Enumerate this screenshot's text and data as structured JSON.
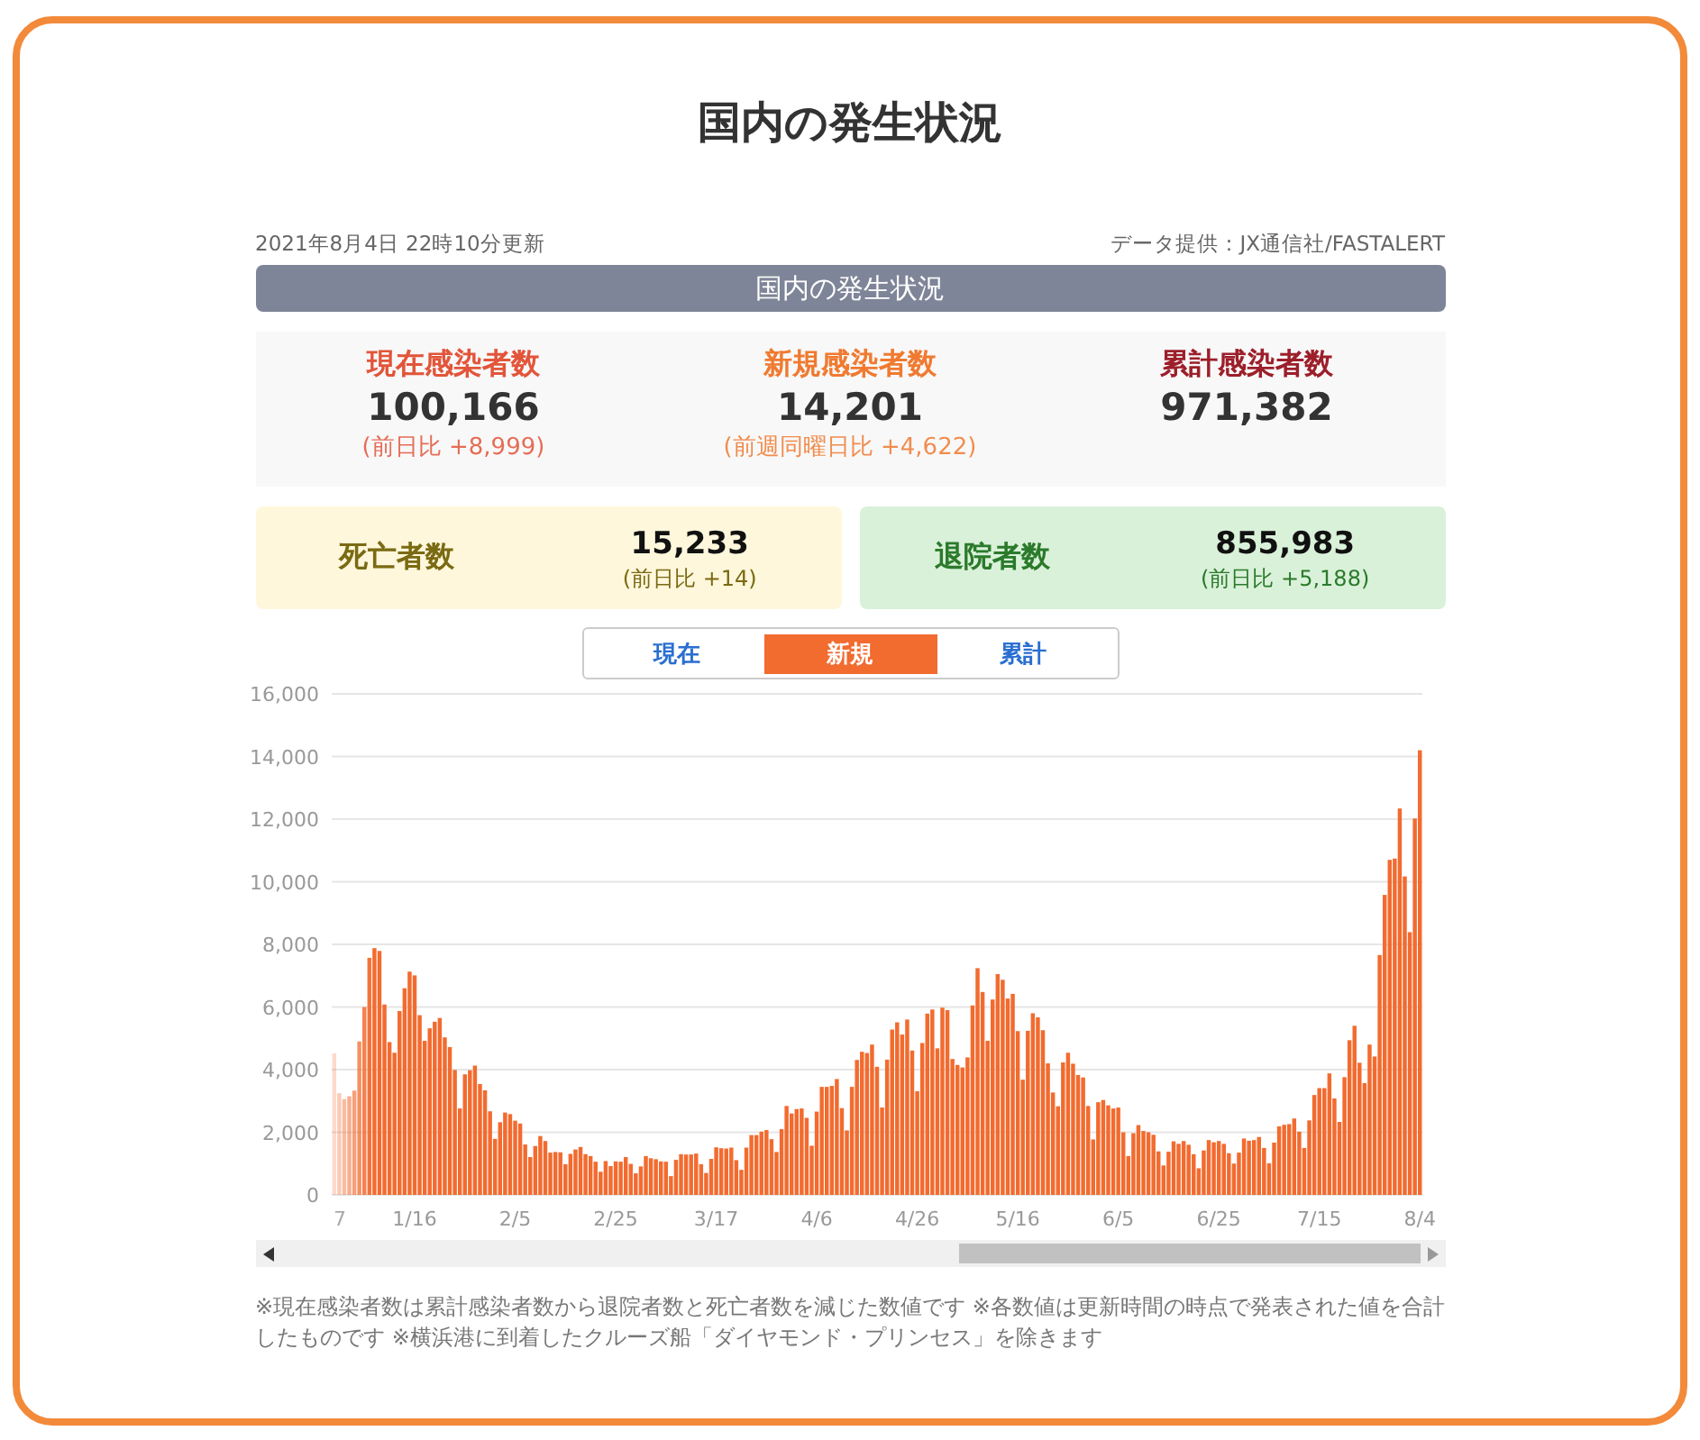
{
  "title": "国内の発生状況",
  "updated": "2021年8月4日 22時10分更新",
  "source": "データ提供：JX通信社/FASTALERT",
  "section_header": "国内の発生状況",
  "stats": [
    {
      "label": "現在感染者数",
      "value": "100,166",
      "change": "(前日比 +8,999)",
      "color": "#e2553a"
    },
    {
      "label": "新規感染者数",
      "value": "14,201",
      "change": "(前週同曜日比 +4,622)",
      "color": "#f07a30"
    },
    {
      "label": "累計感染者数",
      "value": "971,382",
      "color": "#9c1f2a"
    }
  ],
  "cards": [
    {
      "kind": "deaths",
      "label": "死亡者数",
      "value": "15,233",
      "change": "(前日比 +14)"
    },
    {
      "kind": "recovered",
      "label": "退院者数",
      "value": "855,983",
      "change": "(前日比 +5,188)"
    }
  ],
  "tabs": [
    {
      "label": "現在",
      "selected": false
    },
    {
      "label": "新規",
      "selected": true
    },
    {
      "label": "累計",
      "selected": false
    }
  ],
  "chart_data": {
    "type": "bar",
    "grid": true,
    "ylim": [
      0,
      16000
    ],
    "yticks": [
      {
        "value": 0,
        "label": "0"
      },
      {
        "value": 2000,
        "label": "2,000"
      },
      {
        "value": 4000,
        "label": "4,000"
      },
      {
        "value": 6000,
        "label": "6,000"
      },
      {
        "value": 8000,
        "label": "8,000"
      },
      {
        "value": 10000,
        "label": "10,000"
      },
      {
        "value": 12000,
        "label": "12,000"
      },
      {
        "value": 14000,
        "label": "14,000"
      },
      {
        "value": 16000,
        "label": "16,000"
      }
    ],
    "categories": [
      "7",
      null,
      null,
      null,
      null,
      null,
      null,
      null,
      null,
      null,
      null,
      null,
      null,
      null,
      null,
      null,
      "1/16",
      null,
      null,
      null,
      null,
      null,
      null,
      null,
      null,
      null,
      null,
      null,
      null,
      null,
      null,
      null,
      null,
      null,
      null,
      null,
      "2/5",
      null,
      null,
      null,
      null,
      null,
      null,
      null,
      null,
      null,
      null,
      null,
      null,
      null,
      null,
      null,
      null,
      null,
      null,
      null,
      "2/25",
      null,
      null,
      null,
      null,
      null,
      null,
      null,
      null,
      null,
      null,
      null,
      null,
      null,
      null,
      null,
      null,
      null,
      null,
      null,
      "3/17",
      null,
      null,
      null,
      null,
      null,
      null,
      null,
      null,
      null,
      null,
      null,
      null,
      null,
      null,
      null,
      null,
      null,
      null,
      null,
      "4/6",
      null,
      null,
      null,
      null,
      null,
      null,
      null,
      null,
      null,
      null,
      null,
      null,
      null,
      null,
      null,
      null,
      null,
      null,
      null,
      "4/26",
      null,
      null,
      null,
      null,
      null,
      null,
      null,
      null,
      null,
      null,
      null,
      null,
      null,
      null,
      null,
      null,
      null,
      null,
      null,
      "5/16",
      null,
      null,
      null,
      null,
      null,
      null,
      null,
      null,
      null,
      null,
      null,
      null,
      null,
      null,
      null,
      null,
      null,
      null,
      null,
      "6/5",
      null,
      null,
      null,
      null,
      null,
      null,
      null,
      null,
      null,
      null,
      null,
      null,
      null,
      null,
      null,
      null,
      null,
      null,
      null,
      "6/25",
      null,
      null,
      null,
      null,
      null,
      null,
      null,
      null,
      null,
      null,
      null,
      null,
      null,
      null,
      null,
      null,
      null,
      null,
      null,
      "7/15",
      null,
      null,
      null,
      null,
      null,
      null,
      null,
      null,
      null,
      null,
      null,
      null,
      null,
      null,
      null,
      null,
      null,
      null,
      null,
      "8/4"
    ],
    "series": [
      {
        "color": "#f26b2f",
        "values": [
          4520,
          3250,
          3060,
          3150,
          3330,
          4900,
          6000,
          7570,
          7880,
          7790,
          6080,
          4880,
          4540,
          5870,
          6600,
          7130,
          7010,
          5740,
          4920,
          5320,
          5530,
          5650,
          5030,
          4720,
          3990,
          2760,
          3850,
          3980,
          4130,
          3540,
          3340,
          2670,
          1790,
          2320,
          2630,
          2580,
          2370,
          2280,
          1610,
          1210,
          1560,
          1880,
          1720,
          1350,
          1370,
          1360,
          980,
          1310,
          1450,
          1530,
          1300,
          1240,
          1060,
          740,
          1080,
          920,
          1070,
          1060,
          1210,
          990,
          690,
          910,
          1240,
          1170,
          1140,
          1070,
          1060,
          600,
          1120,
          1300,
          1290,
          1290,
          1320,
          980,
          700,
          1150,
          1520,
          1490,
          1480,
          1510,
          1110,
          800,
          1510,
          1910,
          1910,
          2020,
          2070,
          1780,
          1370,
          2100,
          2840,
          2600,
          2740,
          2760,
          2460,
          1570,
          2660,
          3450,
          3450,
          3480,
          3700,
          2770,
          2060,
          3450,
          4310,
          4570,
          4530,
          4800,
          4090,
          2790,
          4320,
          5280,
          5510,
          5120,
          5600,
          4610,
          3310,
          4850,
          5790,
          5920,
          4680,
          5980,
          5900,
          4340,
          4150,
          4070,
          4390,
          6050,
          7240,
          6480,
          4920,
          6240,
          7050,
          6870,
          6270,
          6420,
          5230,
          3680,
          5240,
          5800,
          5670,
          5260,
          4200,
          3270,
          2830,
          4230,
          4540,
          4190,
          3830,
          3750,
          2840,
          1770,
          2960,
          3030,
          2860,
          2760,
          2790,
          2000,
          1240,
          1970,
          2230,
          2040,
          2000,
          1920,
          1390,
          940,
          1380,
          1710,
          1630,
          1720,
          1600,
          1300,
          850,
          1420,
          1750,
          1680,
          1720,
          1630,
          1330,
          1000,
          1350,
          1800,
          1730,
          1750,
          1850,
          1500,
          1010,
          1670,
          2190,
          2240,
          2260,
          2440,
          2020,
          1500,
          2380,
          3190,
          3410,
          3410,
          3880,
          3080,
          2330,
          3760,
          4940,
          5400,
          4220,
          3570,
          4800,
          4420,
          7660,
          9580,
          10700,
          10740,
          12340,
          10170,
          8390,
          12020,
          14200
        ]
      }
    ]
  },
  "footnote": "※現在感染者数は累計感染者数から退院者数と死亡者数を減じた数値です ※各数値は更新時間の時点で発表された値を合計したものです ※横浜港に到着したクルーズ船「ダイヤモンド・プリンセス」を除きます"
}
